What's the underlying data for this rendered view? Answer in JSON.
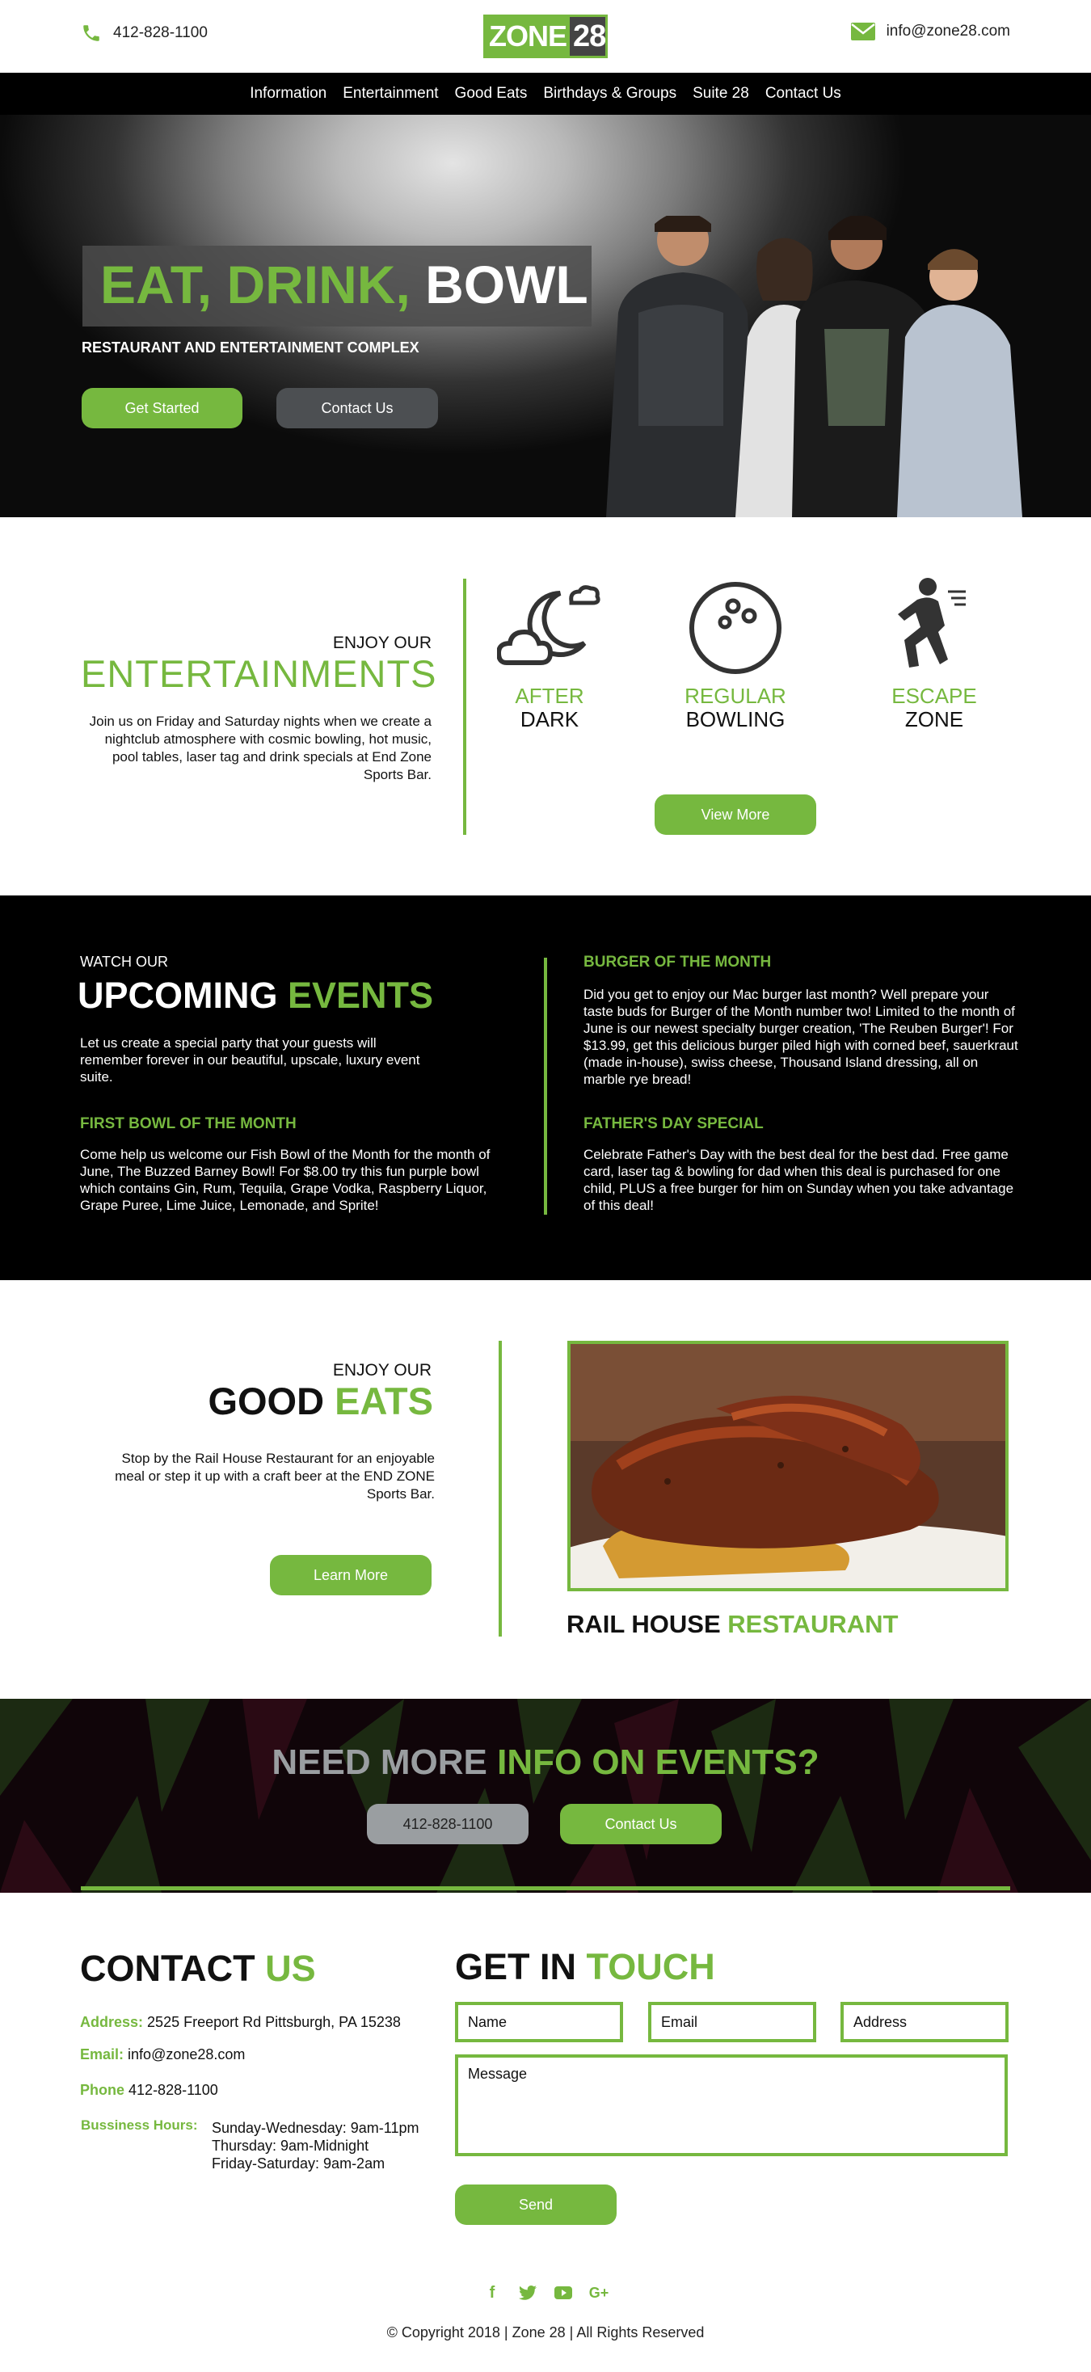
{
  "header": {
    "phone": "412-828-1100",
    "email": "info@zone28.com",
    "logo_left": "ZONE",
    "logo_right": "28"
  },
  "nav": [
    "Information",
    "Entertainment",
    "Good Eats",
    "Birthdays & Groups",
    "Suite 28",
    "Contact Us"
  ],
  "hero": {
    "title_green": "EAT, DRINK,",
    "title_white": "BOWL",
    "subtitle": "RESTAURANT AND ENTERTAINMENT COMPLEX",
    "primary_button": "Get Started",
    "secondary_button": "Contact Us"
  },
  "entertainments": {
    "kicker": "ENJOY OUR",
    "title": "ENTERTAINMENTS",
    "text": "Join us on Friday and Saturday nights when we create a nightclub atmosphere with cosmic bowling, hot music, pool tables, laser tag and drink specials at End Zone Sports Bar.",
    "items": [
      {
        "green": "AFTER",
        "black": "DARK",
        "icon": "moon-cloud-icon"
      },
      {
        "green": "REGULAR",
        "black": "BOWLING",
        "icon": "bowling-ball-icon"
      },
      {
        "green": "ESCAPE",
        "black": "ZONE",
        "icon": "running-person-icon"
      }
    ],
    "button": "View More"
  },
  "events": {
    "kicker": "WATCH OUR",
    "title_white": "UPCOMING",
    "title_green": "EVENTS",
    "intro": "Let us create a special party that your guests will remember forever in our beautiful, upscale, luxury event suite.",
    "items": [
      {
        "title": "FIRST BOWL OF THE MONTH",
        "text": "Come help us welcome our Fish Bowl of the Month for the month of June, The Buzzed Barney Bowl! For $8.00 try this fun purple bowl which contains Gin, Rum, Tequila, Grape Vodka, Raspberry Liquor, Grape Puree, Lime Juice, Lemonade, and Sprite!"
      },
      {
        "title": "BURGER OF THE MONTH",
        "text": "Did you get to enjoy our Mac burger last month? Well prepare your taste buds for Burger of the Month number two! Limited to the month of June is our newest specialty burger creation, 'The Reuben Burger'! For $13.99, get this delicious burger piled high with corned beef, sauerkraut (made in-house), swiss cheese, Thousand Island dressing, all on marble rye bread!"
      },
      {
        "title": "FATHER'S DAY SPECIAL",
        "text": "Celebrate Father's Day with the best deal for the best dad. Free game card, laser tag & bowling for dad when this deal is purchased for one child, PLUS a free burger for him on Sunday when you take advantage of this deal!"
      }
    ]
  },
  "good_eats": {
    "kicker": "ENJOY OUR",
    "title_black": "GOOD",
    "title_green": "EATS",
    "text": "Stop by the Rail House Restaurant for an enjoyable meal or step it up with a craft beer at the END ZONE Sports Bar.",
    "button": "Learn More",
    "restaurant_black": "RAIL HOUSE",
    "restaurant_green": "RESTAURANT"
  },
  "cta": {
    "title_gray": "NEED MORE",
    "title_green": "INFO ON EVENTS?",
    "phone_button": "412-828-1100",
    "contact_button": "Contact Us"
  },
  "contact": {
    "title_black": "CONTACT",
    "title_green": "US",
    "address_label": "Address:",
    "address": "2525 Freeport Rd Pittsburgh, PA 15238",
    "email_label": "Email:",
    "email": "info@zone28.com",
    "phone_label": "Phone",
    "phone": "412-828-1100",
    "hours_label": "Bussiness Hours:",
    "hours": [
      "Sunday-Wednesday:  9am-11pm",
      "Thursday:  9am-Midnight",
      "Friday-Saturday:  9am-2am"
    ]
  },
  "form": {
    "title_black": "GET IN",
    "title_green": "TOUCH",
    "name": "Name",
    "email": "Email",
    "address": "Address",
    "message": "Message",
    "send": "Send"
  },
  "footer": {
    "social": [
      "facebook-icon",
      "twitter-icon",
      "youtube-icon",
      "google-plus-icon"
    ],
    "copyright": "© Copyright 2018 | Zone 28 | All Rights Reserved"
  },
  "colors": {
    "accent": "#76b83f",
    "dark": "#000000",
    "button_dark": "#4c4f52"
  }
}
